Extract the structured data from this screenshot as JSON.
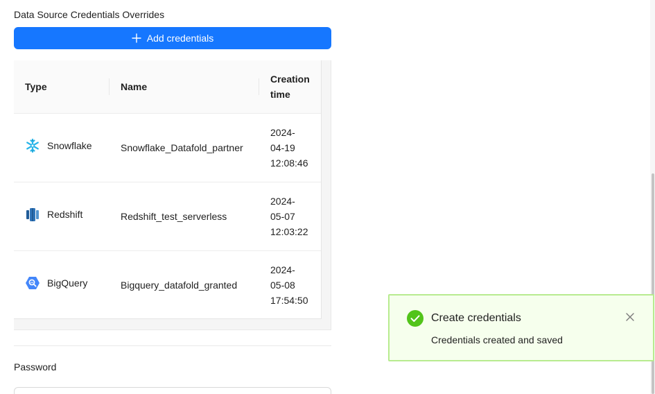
{
  "section": {
    "title": "Data Source Credentials Overrides"
  },
  "toolbar": {
    "add_label": "Add credentials"
  },
  "table": {
    "columns": {
      "type": "Type",
      "name": "Name",
      "creation_time_line1": "Creation",
      "creation_time_line2": "time"
    },
    "rows": [
      {
        "type": "Snowflake",
        "icon": "snowflake-icon",
        "name": "Snowflake_Datafold_partner",
        "date1": "2024-",
        "date2": "04-19",
        "time": "12:08:46"
      },
      {
        "type": "Redshift",
        "icon": "redshift-icon",
        "name": "Redshift_test_serverless",
        "date1": "2024-",
        "date2": "05-07",
        "time": "12:03:22"
      },
      {
        "type": "BigQuery",
        "icon": "bigquery-icon",
        "name": "Bigquery_datafold_granted",
        "date1": "2024-",
        "date2": "05-08",
        "time": "17:54:50"
      }
    ]
  },
  "password": {
    "label": "Password",
    "value": ""
  },
  "toast": {
    "title": "Create credentials",
    "description": "Credentials created and saved",
    "status": "success"
  },
  "colors": {
    "primary": "#1677ff",
    "success": "#52c41a",
    "toast_bg": "#f6ffed",
    "toast_border": "#b7eb8f",
    "snowflake": "#29b5e8",
    "redshift": "#2e73b8",
    "bigquery": "#4386fa"
  }
}
